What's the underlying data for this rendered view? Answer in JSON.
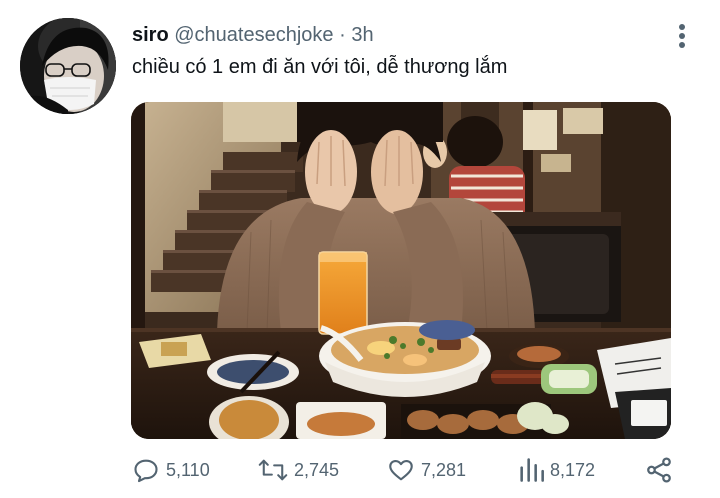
{
  "tweet": {
    "author_name": "siro",
    "author_handle": "@chuatesechjoke",
    "separator": "·",
    "time": "3h",
    "text": "chiều có 1 em đi ăn với tôi, dễ thương lắm"
  },
  "actions": {
    "replies": "5,110",
    "retweets": "2,745",
    "likes": "7,281",
    "views": "8,172"
  },
  "icons": {
    "more": "more-vertical-icon",
    "reply": "comment-icon",
    "retweet": "retweet-icon",
    "like": "heart-icon",
    "views": "bar-chart-icon",
    "share": "share-icon"
  },
  "colors": {
    "text_primary": "#0f1419",
    "text_secondary": "#536471"
  }
}
